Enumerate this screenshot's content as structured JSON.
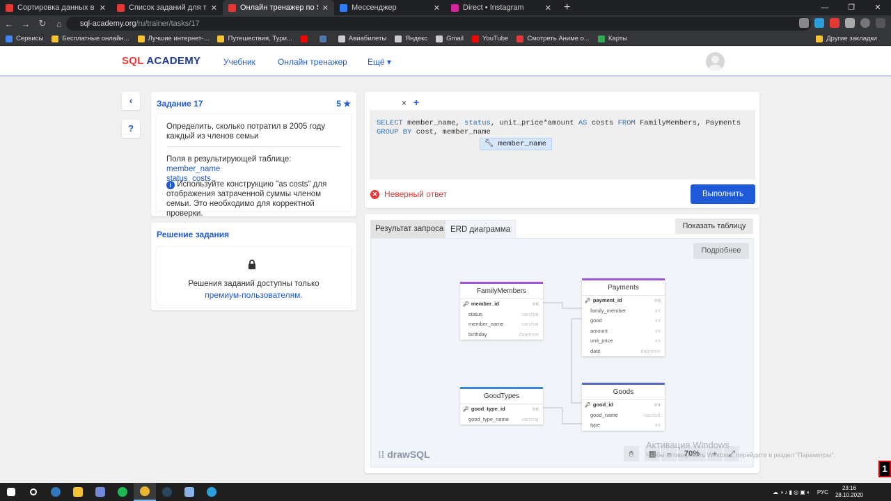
{
  "browser": {
    "tabs": [
      {
        "title": "Сортировка данных в SQL, опер",
        "fav_color": "#e53935",
        "active": false
      },
      {
        "title": "Список заданий для тренировк",
        "fav_color": "#e53935",
        "active": false
      },
      {
        "title": "Онлайн тренажер по SQL",
        "fav_color": "#e53935",
        "active": true
      },
      {
        "title": "Мессенджер",
        "fav_color": "#2d7df6",
        "active": false
      },
      {
        "title": "Direct • Instagram",
        "fav_color": "#d6249f",
        "active": false
      }
    ],
    "url_host": "sql-academy.org",
    "url_path": "/ru/trainer/tasks/17",
    "bookmarks": [
      {
        "label": "Сервисы",
        "color": "#4285f4"
      },
      {
        "label": "Бесплатные онлайн...",
        "color": "#f4c430"
      },
      {
        "label": "Лучшие интернет-...",
        "color": "#f4c430"
      },
      {
        "label": "Путешествия, Тури...",
        "color": "#f4c430"
      },
      {
        "label": "",
        "color": "#ff0000"
      },
      {
        "label": "",
        "color": "#4a76a8"
      },
      {
        "label": "Авиабилеты",
        "color": "#cccccc"
      },
      {
        "label": "Яндекс",
        "color": "#cccccc"
      },
      {
        "label": "Gmail",
        "color": "#cccccc"
      },
      {
        "label": "YouTube",
        "color": "#ff0000"
      },
      {
        "label": "Смотреть Аниме о...",
        "color": "#e53935"
      },
      {
        "label": "Карты",
        "color": "#34a853"
      }
    ],
    "other_bookmarks": "Другие закладки"
  },
  "site": {
    "logo_sql": "SQL",
    "logo_academy": " ACADEMY",
    "nav": [
      "Учебник",
      "Онлайн тренажер",
      "Ещё ▾"
    ]
  },
  "task": {
    "back_icon": "‹",
    "help_icon": "?",
    "title": "Задание 17",
    "stars": "5",
    "description": "Определить, сколько потратил в 2005 году каждый из членов семьи",
    "fields_label": "Поля в результирующей таблице:",
    "fields": [
      "member_name",
      "status",
      "costs"
    ],
    "hint": "Используйте конструкцию \"as costs\" для отображения затраченной суммы членом семьи. Это необходимо для корректной проверки."
  },
  "solution": {
    "title": "Решение задания",
    "text": "Решения заданий доступны только",
    "link": "премиум-пользователям."
  },
  "editor": {
    "close_icon": "×",
    "add_icon": "+",
    "autocomplete": "member_name",
    "error": "Неверный ответ",
    "run_button": "Выполнить"
  },
  "results": {
    "tab_result": "Результат запроса",
    "tab_erd": "ERD диаграмма",
    "show_table": "Показать таблицу",
    "more": "Подробнее",
    "brand": "drawSQL",
    "zoom": "70%"
  },
  "erd": {
    "tables": [
      {
        "name": "FamilyMembers",
        "rows": [
          [
            "member_id",
            "int",
            true
          ],
          [
            "status",
            "varchar",
            false
          ],
          [
            "member_name",
            "varchar",
            false
          ],
          [
            "birthday",
            "datetime",
            false
          ]
        ]
      },
      {
        "name": "Payments",
        "rows": [
          [
            "payment_id",
            "int",
            true
          ],
          [
            "family_member",
            "int",
            false
          ],
          [
            "good",
            "int",
            false
          ],
          [
            "amount",
            "int",
            false
          ],
          [
            "unit_price",
            "int",
            false
          ],
          [
            "date",
            "datetime",
            false
          ]
        ]
      },
      {
        "name": "GoodTypes",
        "rows": [
          [
            "good_type_id",
            "int",
            true
          ],
          [
            "good_type_name",
            "varchar",
            false
          ]
        ]
      },
      {
        "name": "Goods",
        "rows": [
          [
            "good_id",
            "int",
            true
          ],
          [
            "good_name",
            "varchar",
            false
          ],
          [
            "type",
            "int",
            false
          ]
        ]
      }
    ]
  },
  "os": {
    "watermark_title": "Активация Windows",
    "watermark_sub": "Чтобы активировать Windows, перейдите в раздел \"Параметры\".",
    "lang": "РУС",
    "time": "23:16",
    "date": "28.10.2020"
  }
}
